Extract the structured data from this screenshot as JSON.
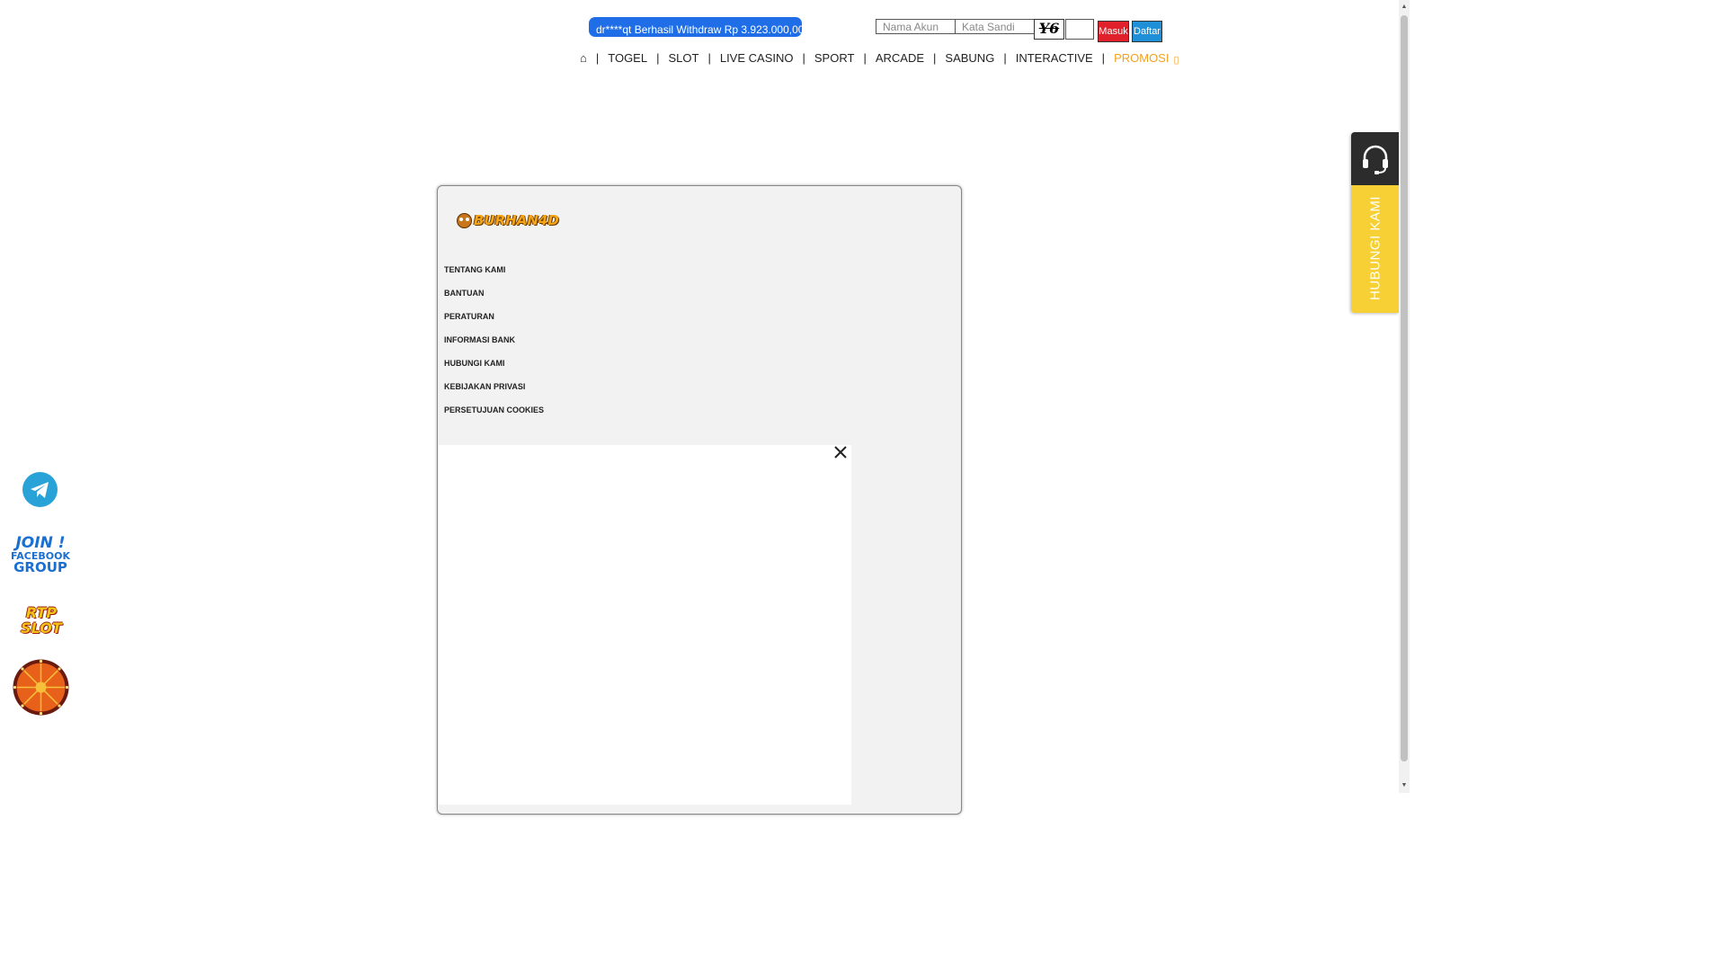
{
  "ticker": {
    "text": "dr****qt Berhasil Withdraw Rp 3.923.000,00"
  },
  "login": {
    "username_placeholder": "Nama Akun",
    "password_placeholder": "Kata Sandi",
    "captcha_text": "Y6",
    "masuk_label": "Masuk",
    "daftar_label": "Daftar"
  },
  "nav": {
    "home_icon": "home-icon",
    "items": [
      "TOGEL",
      "SLOT",
      "LIVE CASINO",
      "SPORT",
      "ARCADE",
      "SABUNG",
      "INTERACTIVE",
      "PROMOSI"
    ],
    "separator": "|",
    "promo_color": "#f2a21e"
  },
  "footer": {
    "logo_text": "BURHAN4D",
    "links": [
      "TENTANG KAMI",
      "BANTUAN",
      "PERATURAN",
      "INFORMASI BANK",
      "HUBUNGI KAMI",
      "KEBIJAKAN PRIVASI",
      "PERSETUJUAN COOKIES"
    ]
  },
  "popup": {
    "close_icon": "close-icon"
  },
  "contact": {
    "label": "HUBUNGI KAMI",
    "icon": "headset-icon",
    "accent": "#f7d035"
  },
  "side_banners": {
    "telegram_icon": "telegram-icon",
    "facebook": {
      "line1": "JOIN !",
      "line2": "FACEBOOK",
      "line3": "GROUP"
    },
    "rtp": {
      "line1": "RTP",
      "line2": "SLOT"
    },
    "wheel_icon": "lucky-wheel-icon"
  }
}
